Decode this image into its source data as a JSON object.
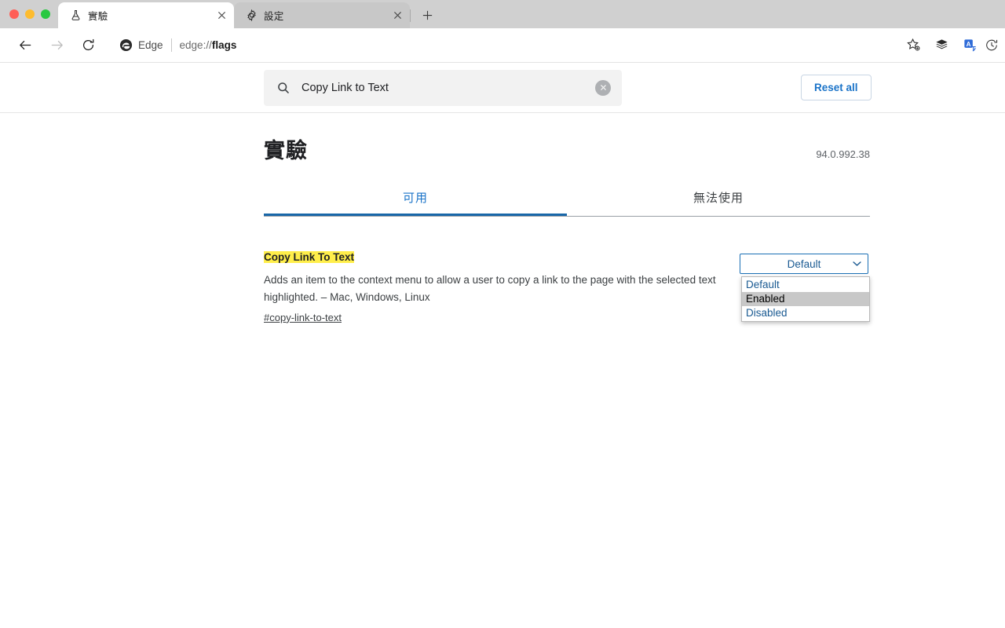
{
  "window": {
    "traffic_lights": [
      "close",
      "minimize",
      "maximize"
    ],
    "colors": {
      "close": "#ff5f57",
      "minimize": "#febc2e",
      "maximize": "#28c840"
    }
  },
  "tabs": [
    {
      "title": "實驗",
      "icon": "flask-icon",
      "active": true,
      "close": "×"
    },
    {
      "title": "設定",
      "icon": "gear-icon",
      "active": false,
      "close": "×"
    }
  ],
  "new_tab_label": "+",
  "toolbar": {
    "back": "back-arrow-icon",
    "forward": "forward-arrow-icon",
    "reload": "reload-icon",
    "edge_label": "Edge",
    "url_scheme": "edge://",
    "url_path": "flags",
    "icons": [
      "favorite-star-icon",
      "collections-icon",
      "translate-icon",
      "history-icon"
    ]
  },
  "search": {
    "value": "Copy Link to Text",
    "placeholder": "Search flags",
    "icon": "search-icon",
    "clear_label": "×"
  },
  "reset_all_label": "Reset all",
  "page": {
    "title": "實驗",
    "version": "94.0.992.38",
    "tabs": [
      {
        "label": "可用",
        "selected": true
      },
      {
        "label": "無法使用",
        "selected": false
      }
    ]
  },
  "flag": {
    "name": "Copy Link To Text",
    "description": "Adds an item to the context menu to allow a user to copy a link to the page with the selected text highlighted. – Mac, Windows, Linux",
    "anchor": "#copy-link-to-text",
    "select": {
      "value": "Default",
      "expanded": true,
      "options": [
        {
          "label": "Default",
          "hovered": false
        },
        {
          "label": "Enabled",
          "hovered": true
        },
        {
          "label": "Disabled",
          "hovered": false
        }
      ]
    }
  },
  "colors": {
    "accent_blue": "#1a73c8",
    "highlight_yellow": "#ffee4a",
    "tabbar_gray": "#d0d0d0",
    "option_hover_gray": "#c8c8c8"
  }
}
